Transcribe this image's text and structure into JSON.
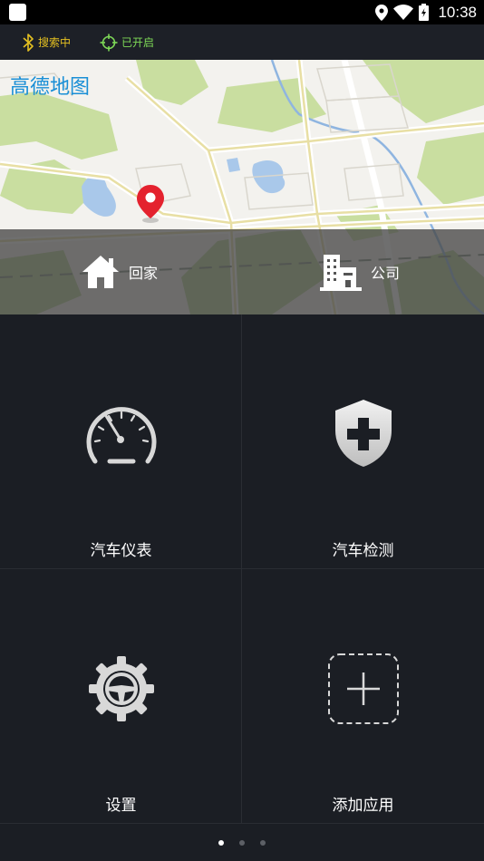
{
  "status_bar": {
    "time": "10:38",
    "icons": [
      "app-icon",
      "location-icon",
      "wifi-icon",
      "battery-icon"
    ]
  },
  "connection": {
    "bluetooth_label": "搜索中",
    "gps_label": "已开启",
    "bluetooth_color": "#e4c021",
    "gps_color": "#7ed957"
  },
  "map": {
    "title": "高德地图",
    "title_color": "#1a8fd6",
    "shortcuts": [
      {
        "label": "回家",
        "icon": "home-icon"
      },
      {
        "label": "公司",
        "icon": "building-icon"
      }
    ]
  },
  "apps": [
    {
      "label": "汽车仪表",
      "icon": "speedometer-icon"
    },
    {
      "label": "汽车检测",
      "icon": "shield-plus-icon"
    },
    {
      "label": "设置",
      "icon": "steering-gear-icon"
    },
    {
      "label": "添加应用",
      "icon": "add-app-icon"
    }
  ],
  "pager": {
    "page_count": 3,
    "current_page": 1
  }
}
